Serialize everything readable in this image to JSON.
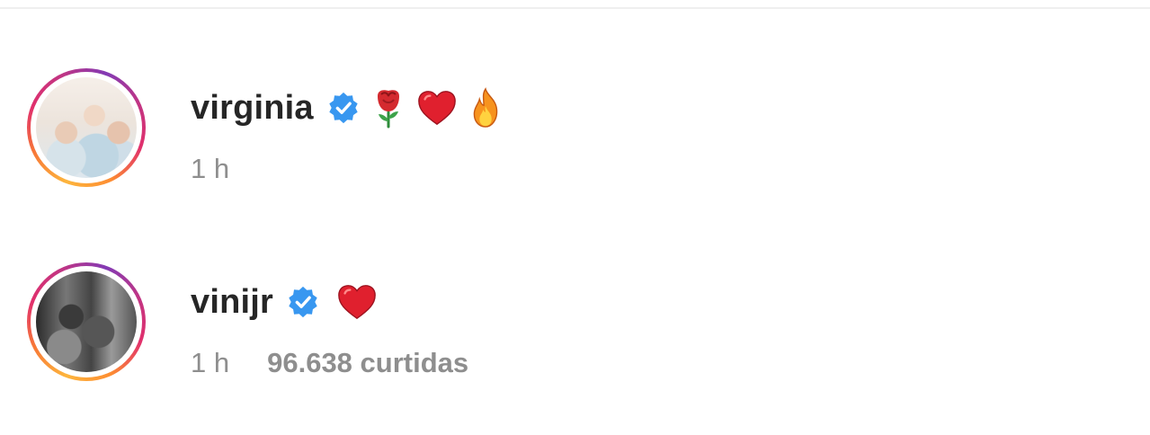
{
  "comments": [
    {
      "username": "virginia",
      "verified": true,
      "emojis": [
        "rose-emoji",
        "red-heart-emoji",
        "fire-emoji"
      ],
      "time": "1 h",
      "likes": ""
    },
    {
      "username": "vinijr",
      "verified": true,
      "emojis": [
        "red-heart-emoji"
      ],
      "time": "1 h",
      "likes": "96.638 curtidas"
    }
  ],
  "colors": {
    "username": "#262626",
    "meta": "#8e8e8e",
    "verified_badge": "#3897f0",
    "heart": "#e0202e",
    "story_ring_start": "#fdb53d",
    "story_ring_end": "#c13584"
  }
}
